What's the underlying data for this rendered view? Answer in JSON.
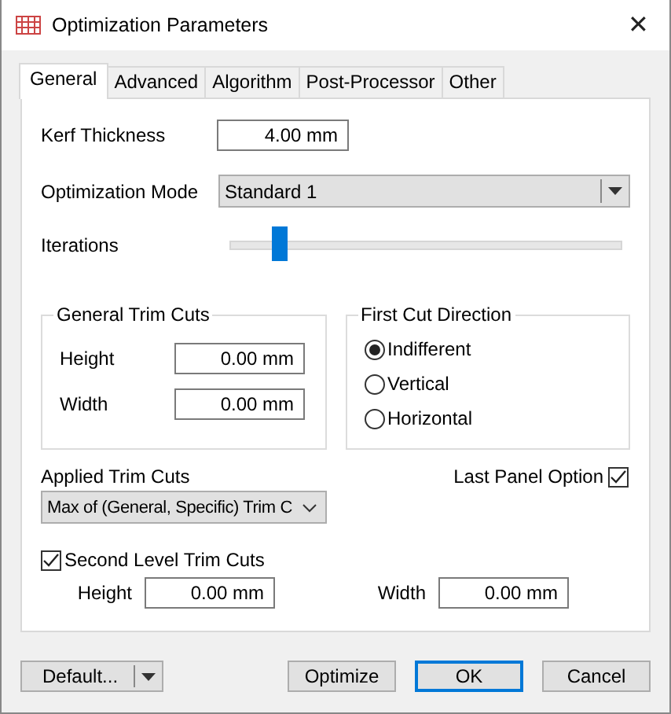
{
  "window": {
    "title": "Optimization Parameters",
    "close": "✕"
  },
  "tabs": [
    {
      "label": "General",
      "selected": true
    },
    {
      "label": "Advanced",
      "selected": false
    },
    {
      "label": "Algorithm",
      "selected": false
    },
    {
      "label": "Post-Processor",
      "selected": false
    },
    {
      "label": "Other",
      "selected": false
    }
  ],
  "kerf_thickness": {
    "label": "Kerf Thickness",
    "value": "4.00 mm"
  },
  "optimization_mode": {
    "label": "Optimization Mode",
    "value": "Standard 1"
  },
  "iterations": {
    "label": "Iterations",
    "level": 0.125
  },
  "general_trim_cuts": {
    "title": "General Trim Cuts",
    "fields": [
      {
        "label": "Height",
        "value": "0.00 mm"
      },
      {
        "label": "Width",
        "value": "0.00 mm"
      }
    ]
  },
  "first_cut_direction": {
    "title": "First Cut Direction",
    "options": [
      {
        "label": "Indifferent",
        "selected": true
      },
      {
        "label": "Vertical",
        "selected": false
      },
      {
        "label": "Horizontal",
        "selected": false
      }
    ]
  },
  "applied_trim_cuts": {
    "label": "Applied Trim Cuts",
    "value": "Max of (General, Specific) Trim C"
  },
  "last_panel_option": {
    "label": "Last Panel Option",
    "checked": true
  },
  "second_level_trim_cuts": {
    "label": "Second Level Trim Cuts",
    "checked": true,
    "fields": [
      {
        "label": "Height",
        "value": "0.00 mm"
      },
      {
        "label": "Width",
        "value": "0.00 mm"
      }
    ]
  },
  "buttons": [
    {
      "label": "Default...",
      "kind": "split",
      "default": false
    },
    {
      "label": "Optimize",
      "kind": "plain",
      "default": false
    },
    {
      "label": "OK",
      "kind": "plain",
      "default": true
    },
    {
      "label": "Cancel",
      "kind": "plain",
      "default": false
    }
  ]
}
